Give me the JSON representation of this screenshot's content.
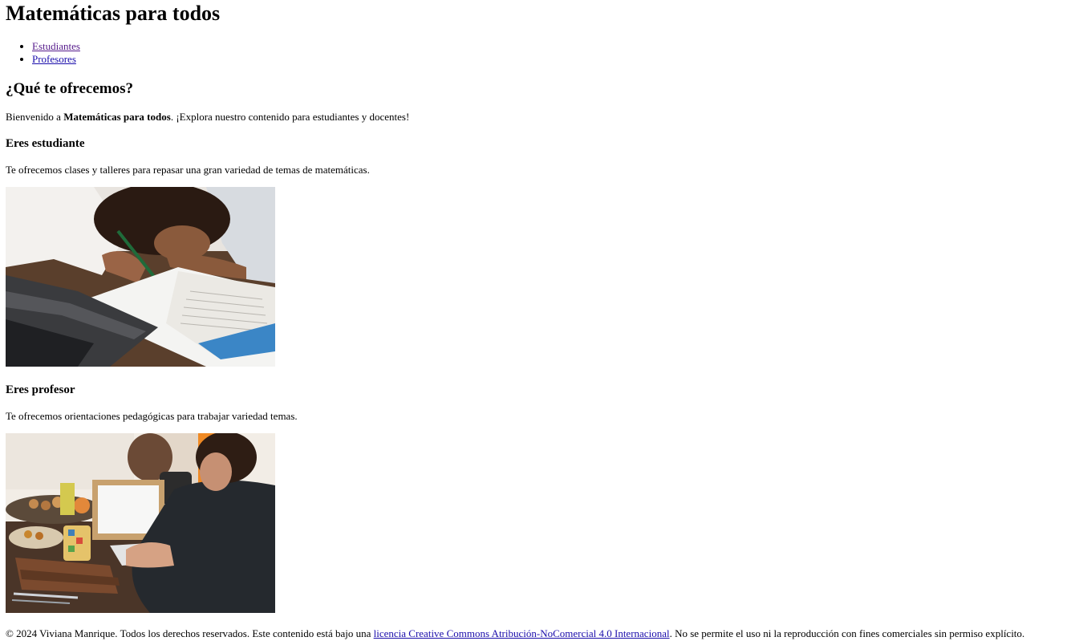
{
  "header": {
    "title": "Matemáticas para todos"
  },
  "nav": {
    "items": [
      "Estudiantes",
      "Profesores"
    ]
  },
  "intro": {
    "heading": "¿Qué te ofrecemos?",
    "text_before": "Bienvenido a ",
    "text_bold": "Matemáticas para todos",
    "text_after": ". ¡Explora nuestro contenido para estudiantes y docentes!"
  },
  "students": {
    "heading": "Eres estudiante",
    "text": "Te ofrecemos clases y talleres para repasar una gran variedad de temas de matemáticas."
  },
  "teachers": {
    "heading": "Eres profesor",
    "text": "Te ofrecemos orientaciones pedagógicas para trabajar variedad temas."
  },
  "footer": {
    "text_before": "© 2024 Viviana Manrique. Todos los derechos reservados. Este contenido está bajo una ",
    "link": "licencia Creative Commons Atribución-NoComercial 4.0 Internacional",
    "text_after": ". No se permite el uso ni la reproducción con fines comerciales sin permiso explícito."
  }
}
